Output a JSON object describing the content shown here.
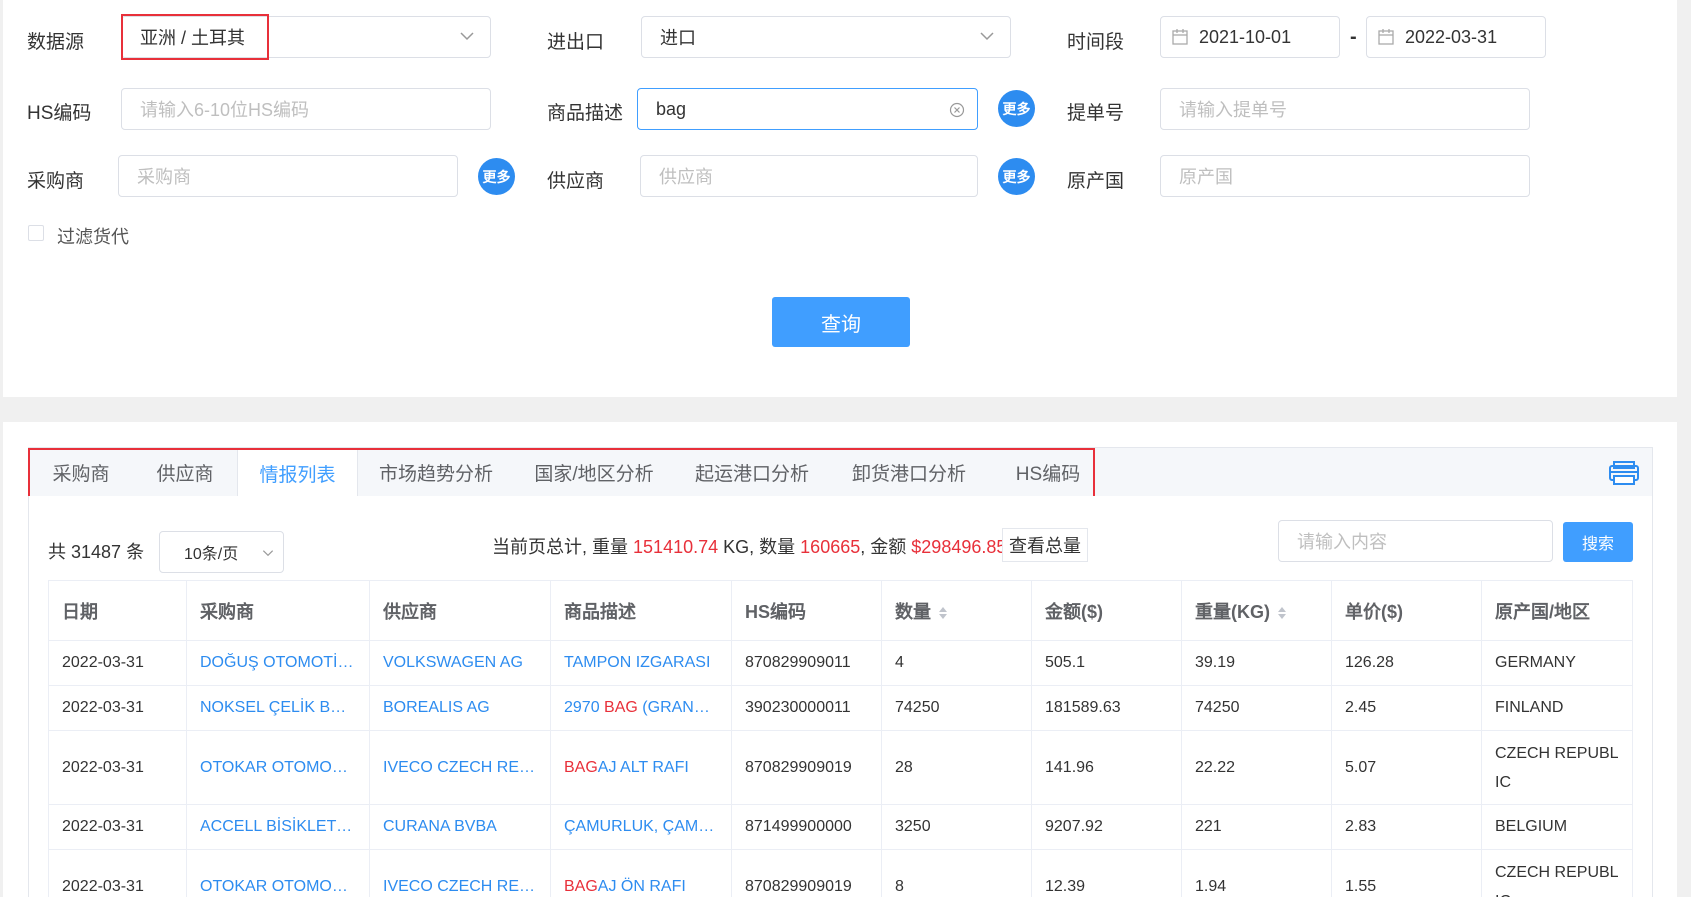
{
  "filters": {
    "datasource": {
      "label": "数据源",
      "value": "亚洲 / 土耳其"
    },
    "import_export": {
      "label": "进出口",
      "value": "进口"
    },
    "period": {
      "label": "时间段",
      "start": "2021-10-01",
      "sep": "-",
      "end": "2022-03-31"
    },
    "hs_code": {
      "label": "HS编码",
      "placeholder": "请输入6-10位HS编码"
    },
    "product_desc": {
      "label": "商品描述",
      "value": "bag"
    },
    "bill_no": {
      "label": "提单号",
      "placeholder": "请输入提单号"
    },
    "buyer": {
      "label": "采购商",
      "placeholder": "采购商"
    },
    "supplier": {
      "label": "供应商",
      "placeholder": "供应商"
    },
    "origin": {
      "label": "原产国",
      "placeholder": "原产国"
    },
    "more_label": "更多",
    "filter_forwarder": "过滤货代",
    "query_button": "查询"
  },
  "tabs": [
    "采购商",
    "供应商",
    "情报列表",
    "市场趋势分析",
    "国家/地区分析",
    "起运港口分析",
    "卸货港口分析",
    "HS编码"
  ],
  "active_tab": 2,
  "summary": {
    "total_prefix": "共",
    "total": "31487",
    "total_suffix": "条",
    "page_size": "10条/页",
    "page_total_prefix": "当前页总计, 重量",
    "weight": "151410.74",
    "weight_unit": "KG, 数量",
    "quantity": "160665",
    "amount_prefix": ", 金额",
    "amount": "$298496.85",
    "view_total": "查看总量",
    "search_placeholder": "请输入内容",
    "search_button": "搜索"
  },
  "table": {
    "headers": [
      "日期",
      "采购商",
      "供应商",
      "商品描述",
      "HS编码",
      "数量",
      "金额($)",
      "重量(KG)",
      "单价($)",
      "原产国/地区"
    ],
    "rows": [
      {
        "date": "2022-03-31",
        "buyer": "DOĞUŞ OTOMOTİV SERVİS VE TİCARET A.Ş.",
        "supplier": "VOLKSWAGEN AG",
        "desc_pre": "TAMPON IZGARASI",
        "desc_hit": "",
        "desc_post": "",
        "hs": "870829909011",
        "qty": "4",
        "amount": "505.1",
        "weight": "39.19",
        "price": "126.28",
        "origin": "GERMANY"
      },
      {
        "date": "2022-03-31",
        "buyer": "NOKSEL ÇELİK BORU SANAYİ A.Ş.",
        "supplier": "BOREALIS AG",
        "desc_pre": "2970 ",
        "desc_hit": "BAG",
        "desc_post": " (GRANÜL)",
        "hs": "390230000011",
        "qty": "74250",
        "amount": "181589.63",
        "weight": "74250",
        "price": "2.45",
        "origin": "FINLAND"
      },
      {
        "date": "2022-03-31",
        "buyer": "OTOKAR OTOMOTİV VE SAVUNMA SANAYİ A.Ş.",
        "supplier": "IVECO CZECH REPUBLIC A.S.",
        "desc_pre": "",
        "desc_hit": "BAG",
        "desc_post": "AJ ALT RAFI",
        "hs": "870829909019",
        "qty": "28",
        "amount": "141.96",
        "weight": "22.22",
        "price": "5.07",
        "origin": "CZECH REPUBLIC"
      },
      {
        "date": "2022-03-31",
        "buyer": "ACCELL BİSİKLET SANAYİ VE TİCARET A.Ş.",
        "supplier": "CURANA BVBA",
        "desc_pre": "ÇAMURLUK, ÇAMURLUK",
        "desc_hit": "",
        "desc_post": "",
        "hs": "871499900000",
        "qty": "3250",
        "amount": "9207.92",
        "weight": "221",
        "price": "2.83",
        "origin": "BELGIUM"
      },
      {
        "date": "2022-03-31",
        "buyer": "OTOKAR OTOMOTİV VE SAVUNMA SANAYİ A.Ş.",
        "supplier": "IVECO CZECH REPUBLIC A.S.",
        "desc_pre": "",
        "desc_hit": "BAG",
        "desc_post": "AJ ÖN RAFI",
        "hs": "870829909019",
        "qty": "8",
        "amount": "12.39",
        "weight": "1.94",
        "price": "1.55",
        "origin": "CZECH REPUBLIC"
      }
    ]
  }
}
